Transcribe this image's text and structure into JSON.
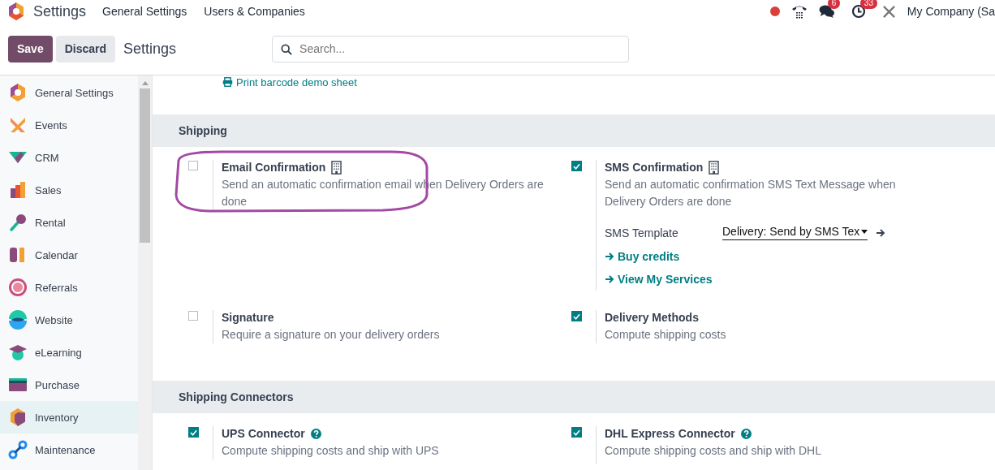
{
  "navbar": {
    "app_title": "Settings",
    "menus": [
      "General Settings",
      "Users & Companies"
    ],
    "chat_count": "6",
    "activity_count": "33",
    "company": "My Company (Sa"
  },
  "control_panel": {
    "buttons": [
      "Save",
      "Discard"
    ],
    "breadcrumb": "Settings",
    "search": {
      "placeholder": "Search..."
    }
  },
  "sidebar": {
    "items": [
      {
        "label": "General Settings",
        "selected": false
      },
      {
        "label": "Events",
        "selected": false
      },
      {
        "label": "CRM",
        "selected": false
      },
      {
        "label": "Sales",
        "selected": false
      },
      {
        "label": "Rental",
        "selected": false
      },
      {
        "label": "Calendar",
        "selected": false
      },
      {
        "label": "Referrals",
        "selected": false
      },
      {
        "label": "Website",
        "selected": false
      },
      {
        "label": "eLearning",
        "selected": false
      },
      {
        "label": "Purchase",
        "selected": false
      },
      {
        "label": "Inventory",
        "selected": true
      },
      {
        "label": "Maintenance",
        "selected": false
      }
    ]
  },
  "top_link": "Print barcode demo sheet",
  "sections": [
    {
      "title": "Shipping",
      "settings": [
        {
          "title": "Email Confirmation",
          "highlighted": true,
          "checked": false,
          "description": "Send an automatic confirmation email when Delivery Orders are done"
        },
        {
          "title": "SMS Confirmation",
          "highlighted": false,
          "checked": true,
          "description": "Send an automatic confirmation SMS Text Message when Delivery Orders are done",
          "field": {
            "label": "SMS Template",
            "value": "Delivery: Send by SMS Tex"
          },
          "links": [
            "Buy credits",
            "View My Services"
          ]
        },
        {
          "title": "Signature",
          "highlighted": false,
          "checked": false,
          "description": "Require a signature on your delivery orders"
        },
        {
          "title": "Delivery Methods",
          "highlighted": false,
          "checked": true,
          "description": "Compute shipping costs"
        }
      ]
    },
    {
      "title": "Shipping Connectors",
      "settings": [
        {
          "title": "UPS Connector",
          "highlighted": false,
          "checked": true,
          "description": "Compute shipping costs and ship with UPS"
        },
        {
          "title": "DHL Express Connector",
          "highlighted": false,
          "checked": true,
          "description": "Compute shipping costs and ship with DHL"
        }
      ]
    }
  ]
}
